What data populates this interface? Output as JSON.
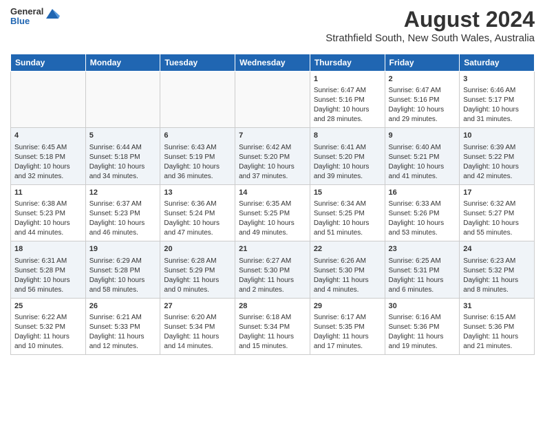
{
  "header": {
    "logo_line1": "General",
    "logo_line2": "Blue",
    "title": "August 2024",
    "subtitle": "Strathfield South, New South Wales, Australia"
  },
  "days_of_week": [
    "Sunday",
    "Monday",
    "Tuesday",
    "Wednesday",
    "Thursday",
    "Friday",
    "Saturday"
  ],
  "weeks": [
    [
      {
        "day": "",
        "content": ""
      },
      {
        "day": "",
        "content": ""
      },
      {
        "day": "",
        "content": ""
      },
      {
        "day": "",
        "content": ""
      },
      {
        "day": "1",
        "content": "Sunrise: 6:47 AM\nSunset: 5:16 PM\nDaylight: 10 hours\nand 28 minutes."
      },
      {
        "day": "2",
        "content": "Sunrise: 6:47 AM\nSunset: 5:16 PM\nDaylight: 10 hours\nand 29 minutes."
      },
      {
        "day": "3",
        "content": "Sunrise: 6:46 AM\nSunset: 5:17 PM\nDaylight: 10 hours\nand 31 minutes."
      }
    ],
    [
      {
        "day": "4",
        "content": "Sunrise: 6:45 AM\nSunset: 5:18 PM\nDaylight: 10 hours\nand 32 minutes."
      },
      {
        "day": "5",
        "content": "Sunrise: 6:44 AM\nSunset: 5:18 PM\nDaylight: 10 hours\nand 34 minutes."
      },
      {
        "day": "6",
        "content": "Sunrise: 6:43 AM\nSunset: 5:19 PM\nDaylight: 10 hours\nand 36 minutes."
      },
      {
        "day": "7",
        "content": "Sunrise: 6:42 AM\nSunset: 5:20 PM\nDaylight: 10 hours\nand 37 minutes."
      },
      {
        "day": "8",
        "content": "Sunrise: 6:41 AM\nSunset: 5:20 PM\nDaylight: 10 hours\nand 39 minutes."
      },
      {
        "day": "9",
        "content": "Sunrise: 6:40 AM\nSunset: 5:21 PM\nDaylight: 10 hours\nand 41 minutes."
      },
      {
        "day": "10",
        "content": "Sunrise: 6:39 AM\nSunset: 5:22 PM\nDaylight: 10 hours\nand 42 minutes."
      }
    ],
    [
      {
        "day": "11",
        "content": "Sunrise: 6:38 AM\nSunset: 5:23 PM\nDaylight: 10 hours\nand 44 minutes."
      },
      {
        "day": "12",
        "content": "Sunrise: 6:37 AM\nSunset: 5:23 PM\nDaylight: 10 hours\nand 46 minutes."
      },
      {
        "day": "13",
        "content": "Sunrise: 6:36 AM\nSunset: 5:24 PM\nDaylight: 10 hours\nand 47 minutes."
      },
      {
        "day": "14",
        "content": "Sunrise: 6:35 AM\nSunset: 5:25 PM\nDaylight: 10 hours\nand 49 minutes."
      },
      {
        "day": "15",
        "content": "Sunrise: 6:34 AM\nSunset: 5:25 PM\nDaylight: 10 hours\nand 51 minutes."
      },
      {
        "day": "16",
        "content": "Sunrise: 6:33 AM\nSunset: 5:26 PM\nDaylight: 10 hours\nand 53 minutes."
      },
      {
        "day": "17",
        "content": "Sunrise: 6:32 AM\nSunset: 5:27 PM\nDaylight: 10 hours\nand 55 minutes."
      }
    ],
    [
      {
        "day": "18",
        "content": "Sunrise: 6:31 AM\nSunset: 5:28 PM\nDaylight: 10 hours\nand 56 minutes."
      },
      {
        "day": "19",
        "content": "Sunrise: 6:29 AM\nSunset: 5:28 PM\nDaylight: 10 hours\nand 58 minutes."
      },
      {
        "day": "20",
        "content": "Sunrise: 6:28 AM\nSunset: 5:29 PM\nDaylight: 11 hours\nand 0 minutes."
      },
      {
        "day": "21",
        "content": "Sunrise: 6:27 AM\nSunset: 5:30 PM\nDaylight: 11 hours\nand 2 minutes."
      },
      {
        "day": "22",
        "content": "Sunrise: 6:26 AM\nSunset: 5:30 PM\nDaylight: 11 hours\nand 4 minutes."
      },
      {
        "day": "23",
        "content": "Sunrise: 6:25 AM\nSunset: 5:31 PM\nDaylight: 11 hours\nand 6 minutes."
      },
      {
        "day": "24",
        "content": "Sunrise: 6:23 AM\nSunset: 5:32 PM\nDaylight: 11 hours\nand 8 minutes."
      }
    ],
    [
      {
        "day": "25",
        "content": "Sunrise: 6:22 AM\nSunset: 5:32 PM\nDaylight: 11 hours\nand 10 minutes."
      },
      {
        "day": "26",
        "content": "Sunrise: 6:21 AM\nSunset: 5:33 PM\nDaylight: 11 hours\nand 12 minutes."
      },
      {
        "day": "27",
        "content": "Sunrise: 6:20 AM\nSunset: 5:34 PM\nDaylight: 11 hours\nand 14 minutes."
      },
      {
        "day": "28",
        "content": "Sunrise: 6:18 AM\nSunset: 5:34 PM\nDaylight: 11 hours\nand 15 minutes."
      },
      {
        "day": "29",
        "content": "Sunrise: 6:17 AM\nSunset: 5:35 PM\nDaylight: 11 hours\nand 17 minutes."
      },
      {
        "day": "30",
        "content": "Sunrise: 6:16 AM\nSunset: 5:36 PM\nDaylight: 11 hours\nand 19 minutes."
      },
      {
        "day": "31",
        "content": "Sunrise: 6:15 AM\nSunset: 5:36 PM\nDaylight: 11 hours\nand 21 minutes."
      }
    ]
  ]
}
